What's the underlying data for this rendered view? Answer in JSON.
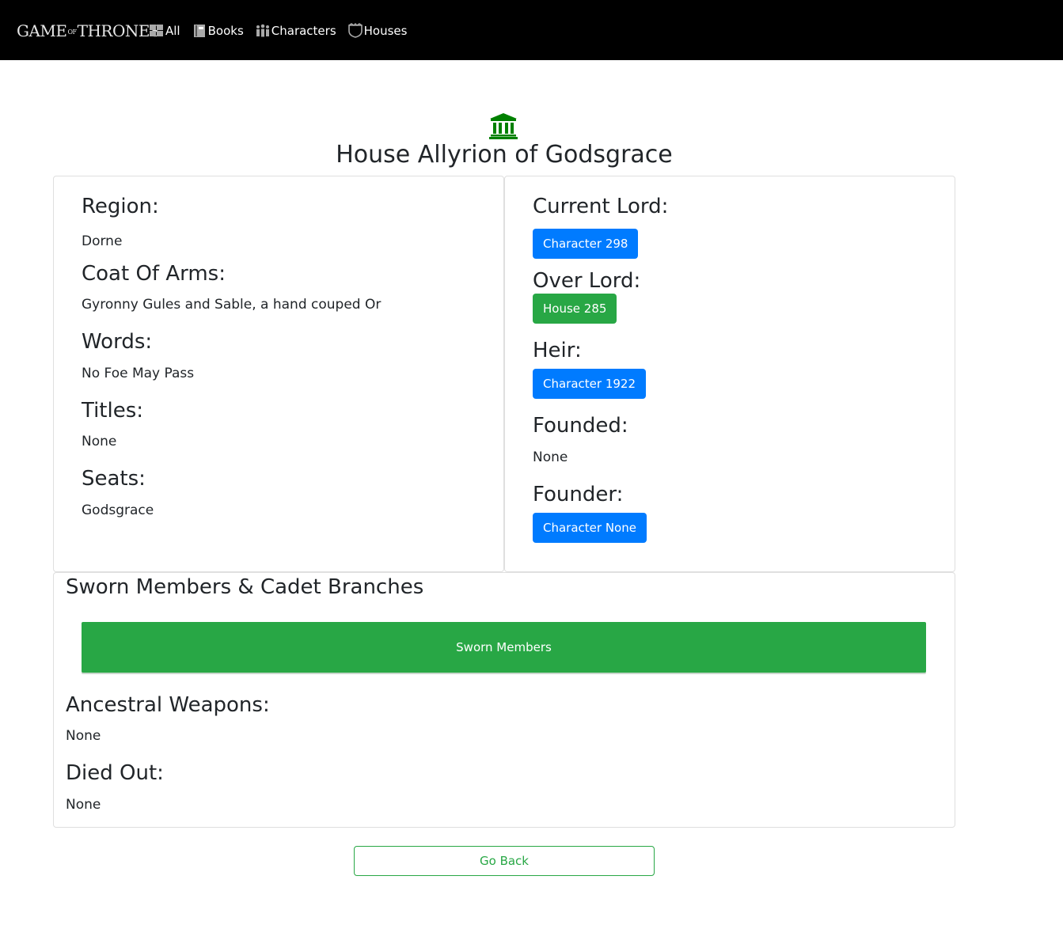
{
  "nav": {
    "brand": {
      "part1": "GAME",
      "part2": "OF",
      "part3": "THRONES"
    },
    "links": [
      {
        "label": "All",
        "icon": "grid-icon"
      },
      {
        "label": "Books",
        "icon": "book-icon"
      },
      {
        "label": "Characters",
        "icon": "people-icon"
      },
      {
        "label": "Houses",
        "icon": "shield-icon"
      }
    ]
  },
  "header": {
    "icon": "institution-icon",
    "icon_color": "#008000",
    "title": "House Allyrion of Godsgrace"
  },
  "left": {
    "region_label": "Region:",
    "region": "Dorne",
    "coat_label": "Coat Of Arms:",
    "coat": "Gyronny Gules and Sable, a hand couped Or",
    "words_label": "Words:",
    "words": "No Foe May Pass",
    "titles_label": "Titles:",
    "titles": "None",
    "seats_label": "Seats:",
    "seats": "Godsgrace"
  },
  "right": {
    "current_lord_label": "Current Lord:",
    "current_lord": "Character 298",
    "over_lord_label": "Over Lord:",
    "over_lord": "House 285",
    "heir_label": "Heir:",
    "heir": "Character 1922",
    "founded_label": "Founded:",
    "founded": "None",
    "founder_label": "Founder:",
    "founder": "Character None"
  },
  "bottom": {
    "sworn_title": "Sworn Members & Cadet Branches",
    "sworn_button": "Sworn Members",
    "weapons_label": "Ancestral Weapons:",
    "weapons": "None",
    "died_label": "Died Out:",
    "died": "None"
  },
  "go_back": "Go Back",
  "colors": {
    "primary": "#007bff",
    "success": "#28a745",
    "navbar": "#000000"
  }
}
